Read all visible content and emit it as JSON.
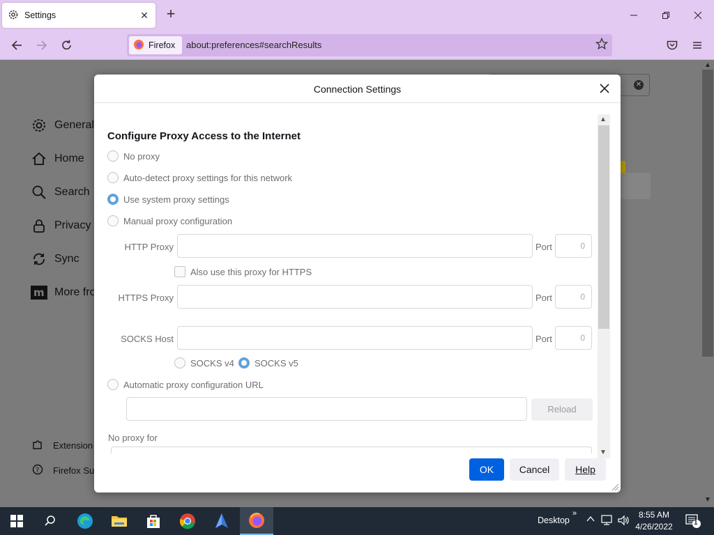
{
  "browser": {
    "tab_title": "Settings",
    "identity_label": "Firefox",
    "url": "about:preferences#searchResults"
  },
  "sidebar": {
    "items": [
      {
        "label": "General",
        "icon": "gear-icon"
      },
      {
        "label": "Home",
        "icon": "home-icon"
      },
      {
        "label": "Search",
        "icon": "search-icon"
      },
      {
        "label": "Privacy &",
        "icon": "lock-icon"
      },
      {
        "label": "Sync",
        "icon": "sync-icon"
      },
      {
        "label": "More fro",
        "icon": "mozilla-icon"
      }
    ],
    "footer": [
      {
        "label": "Extension",
        "icon": "puzzle-icon"
      },
      {
        "label": "Firefox Su",
        "icon": "help-icon"
      }
    ]
  },
  "dialog": {
    "title": "Connection Settings",
    "section_title": "Configure Proxy Access to the Internet",
    "radios": [
      {
        "label": "No proxy",
        "selected": false
      },
      {
        "label": "Auto-detect proxy settings for this network",
        "selected": false
      },
      {
        "label": "Use system proxy settings",
        "selected": true
      },
      {
        "label": "Manual proxy configuration",
        "selected": false
      }
    ],
    "http_proxy_label": "HTTP Proxy",
    "http_port_label": "Port",
    "http_port_value": "0",
    "also_https_label": "Also use this proxy for HTTPS",
    "https_proxy_label": "HTTPS Proxy",
    "https_port_label": "Port",
    "https_port_value": "0",
    "socks_host_label": "SOCKS Host",
    "socks_port_label": "Port",
    "socks_port_value": "0",
    "socks_v4_label": "SOCKS v4",
    "socks_v5_label": "SOCKS v5",
    "auto_url_label": "Automatic proxy configuration URL",
    "reload_label": "Reload",
    "no_proxy_label": "No proxy for",
    "ok_label": "OK",
    "cancel_label": "Cancel",
    "help_label": "Help"
  },
  "taskbar": {
    "desktop_label": "Desktop",
    "time": "8:55 AM",
    "date": "4/26/2022",
    "notification_count": "1"
  },
  "colors": {
    "chrome": "#e3caf2",
    "accent": "#0061e0",
    "radio_selected": "#63a0dd"
  }
}
